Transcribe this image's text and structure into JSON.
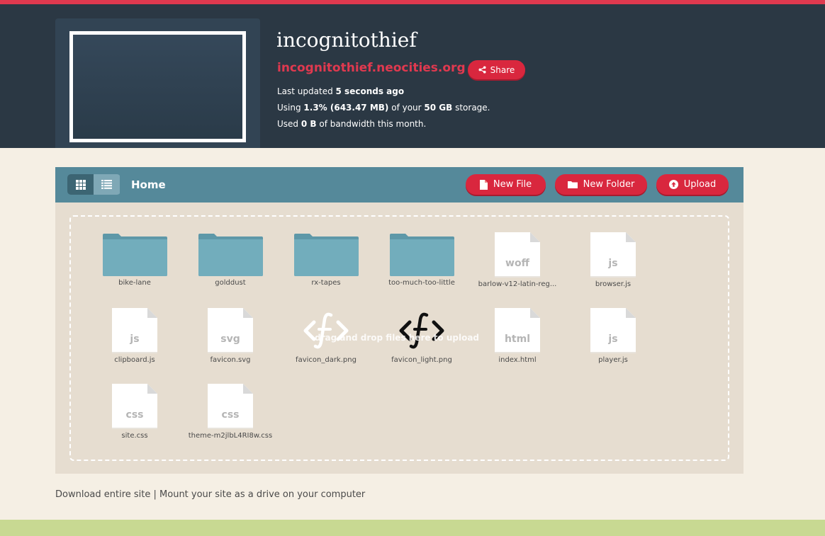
{
  "site": {
    "title": "incognitothief",
    "url": "incognitothief.neocities.org",
    "share_label": "Share",
    "updated_prefix": "Last updated ",
    "updated_value": "5 seconds ago",
    "storage_prefix": "Using ",
    "storage_value": "1.3% (643.47 MB)",
    "storage_mid": " of your ",
    "storage_total": "50 GB",
    "storage_suffix": " storage.",
    "bandwidth_prefix": "Used ",
    "bandwidth_value": "0 B",
    "bandwidth_suffix": " of bandwidth this month."
  },
  "toolbar": {
    "breadcrumb": "Home",
    "new_file": "New File",
    "new_folder": "New Folder",
    "upload": "Upload"
  },
  "dropzone": {
    "hint": "drag and drop files here to upload"
  },
  "files": [
    {
      "name": "bike-lane",
      "kind": "folder"
    },
    {
      "name": "golddust",
      "kind": "folder"
    },
    {
      "name": "rx-tapes",
      "kind": "folder"
    },
    {
      "name": "too-much-too-little",
      "kind": "folder"
    },
    {
      "name": "barlow-v12-latin-reg...",
      "kind": "file",
      "ext": "woff"
    },
    {
      "name": "browser.js",
      "kind": "file",
      "ext": "js"
    },
    {
      "name": "clipboard.js",
      "kind": "file",
      "ext": "js"
    },
    {
      "name": "favicon.svg",
      "kind": "file",
      "ext": "svg"
    },
    {
      "name": "favicon_dark.png",
      "kind": "image",
      "glyph": "<f>"
    },
    {
      "name": "favicon_light.png",
      "kind": "image",
      "glyph": "<f>"
    },
    {
      "name": "index.html",
      "kind": "file",
      "ext": "html"
    },
    {
      "name": "player.js",
      "kind": "file",
      "ext": "js"
    },
    {
      "name": "site.css",
      "kind": "file",
      "ext": "css"
    },
    {
      "name": "theme-m2jlbL4RI8w.css",
      "kind": "file",
      "ext": "css"
    }
  ],
  "footer": {
    "download": "Download entire site",
    "separator": " | ",
    "mount": "Mount your site as a drive on your computer"
  },
  "colors": {
    "accent": "#e0394f",
    "header_bg": "#2b3844",
    "toolbar_bg": "#55899a",
    "button_red": "#d9273e",
    "folder": "#6fa9b8"
  }
}
